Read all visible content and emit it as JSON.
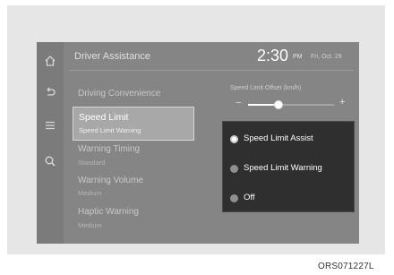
{
  "header": {
    "title": "Driver Assistance",
    "time": "2:30",
    "ampm": "PM",
    "date": "Fri, Oct. 29"
  },
  "sidebar": {
    "icons": [
      "home-icon",
      "back-icon",
      "menu-icon",
      "search-icon"
    ]
  },
  "menu": {
    "items": [
      {
        "label": "Driving Convenience"
      },
      {
        "label": "Speed Limit",
        "sub": "Speed Limit Warning"
      },
      {
        "label": "Warning Timing",
        "sub": "Standard"
      },
      {
        "label": "Warning Volume",
        "sub": "Medium"
      },
      {
        "label": "Haptic Warning",
        "sub": "Medium"
      }
    ]
  },
  "offset": {
    "label": "Speed Limit Offset (km/h)",
    "minus": "−",
    "plus": "+",
    "value_fraction": 0.35
  },
  "popup": {
    "options": [
      {
        "label": "Speed Limit Assist",
        "selected": true
      },
      {
        "label": "Speed Limit Warning",
        "selected": false
      },
      {
        "label": "Off",
        "selected": false
      }
    ]
  },
  "caption": "ORS071227L"
}
